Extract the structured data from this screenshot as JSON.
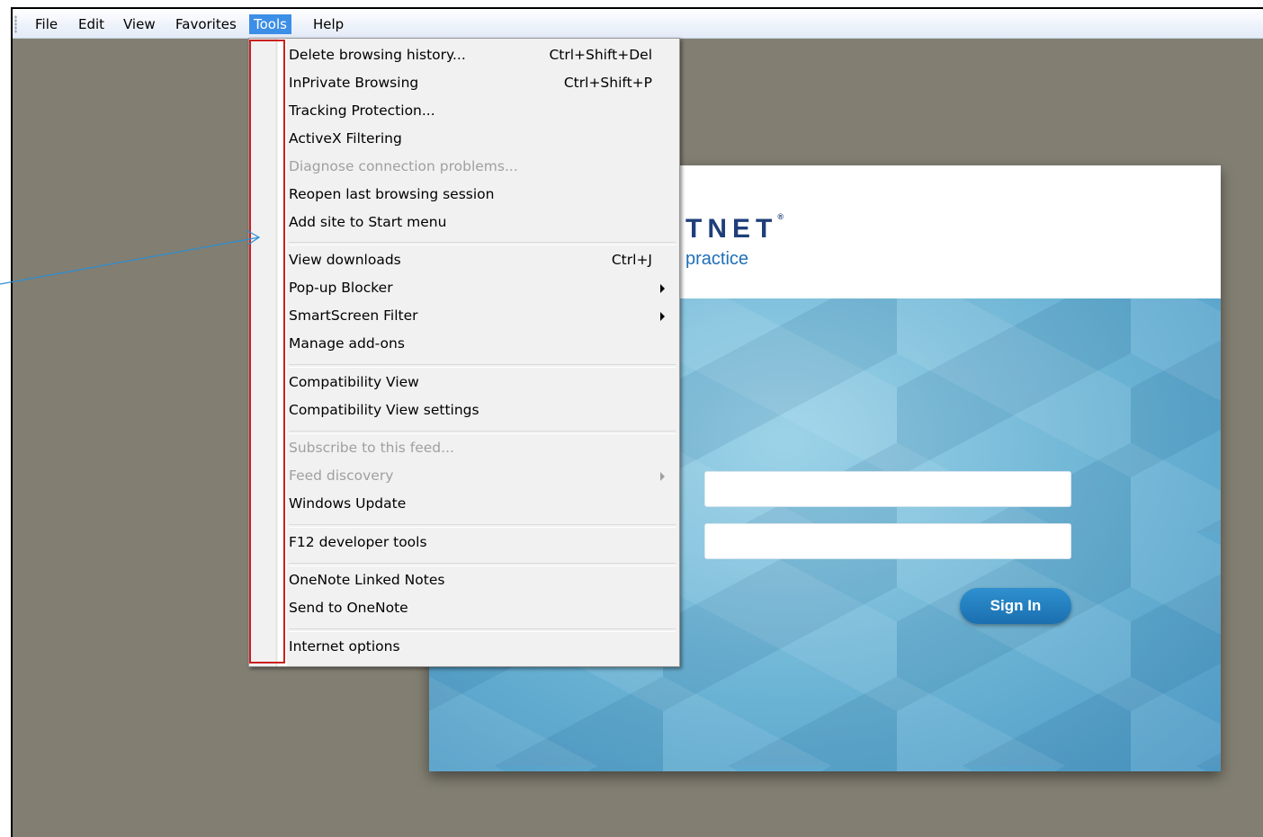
{
  "menubar": {
    "items": [
      {
        "label": "File"
      },
      {
        "label": "Edit"
      },
      {
        "label": "View"
      },
      {
        "label": "Favorites"
      },
      {
        "label": "Tools",
        "active": true
      },
      {
        "label": "Help"
      }
    ]
  },
  "tools_menu": {
    "items": [
      {
        "label": "Delete browsing history...",
        "shortcut": "Ctrl+Shift+Del"
      },
      {
        "label": "InPrivate Browsing",
        "shortcut": "Ctrl+Shift+P"
      },
      {
        "label": "Tracking Protection..."
      },
      {
        "label": "ActiveX Filtering"
      },
      {
        "label": "Diagnose connection problems...",
        "disabled": true
      },
      {
        "label": "Reopen last browsing session"
      },
      {
        "label": "Add site to Start menu"
      },
      {
        "label": "View downloads",
        "shortcut": "Ctrl+J"
      },
      {
        "label": "Pop-up Blocker",
        "submenu": true
      },
      {
        "label": "SmartScreen Filter",
        "submenu": true
      },
      {
        "label": "Manage add-ons"
      },
      {
        "label": "Compatibility View"
      },
      {
        "label": "Compatibility View settings"
      },
      {
        "label": "Subscribe to this feed...",
        "disabled": true
      },
      {
        "label": "Feed discovery",
        "disabled": true,
        "submenu": true
      },
      {
        "label": "Windows Update"
      },
      {
        "label": "F12 developer tools"
      },
      {
        "label": "OneNote Linked Notes"
      },
      {
        "label": "Send to OneNote"
      },
      {
        "label": "Internet options"
      }
    ]
  },
  "page": {
    "logo_text": "TNET",
    "logo_mark": "®",
    "tagline": "practice",
    "username_value": "",
    "password_value": "",
    "signin_label": "Sign In"
  },
  "colors": {
    "menu_active": "#3d8ee6",
    "highlight_box": "#cc1f1f",
    "callout_line": "#2a8fd4",
    "page_background": "#827e72"
  }
}
